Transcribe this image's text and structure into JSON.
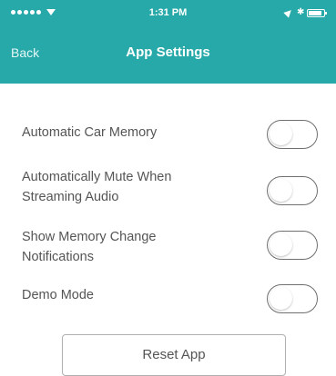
{
  "status_bar": {
    "time": "1:31 PM",
    "signal_dots": 5,
    "bluetooth_symbol": "✱"
  },
  "nav": {
    "back_label": "Back",
    "title": "App Settings"
  },
  "settings": [
    {
      "lines": [
        "Automatic Car Memory"
      ],
      "enabled": false
    },
    {
      "lines": [
        "Automatically Mute When",
        "Streaming Audio"
      ],
      "enabled": false
    },
    {
      "lines": [
        "Show Memory Change",
        "Notifications"
      ],
      "enabled": false
    },
    {
      "lines": [
        "Demo Mode"
      ],
      "enabled": false
    }
  ],
  "reset_label": "Reset App",
  "colors": {
    "header": "#27a9a9",
    "text": "#555555",
    "background": "#ffffff"
  }
}
